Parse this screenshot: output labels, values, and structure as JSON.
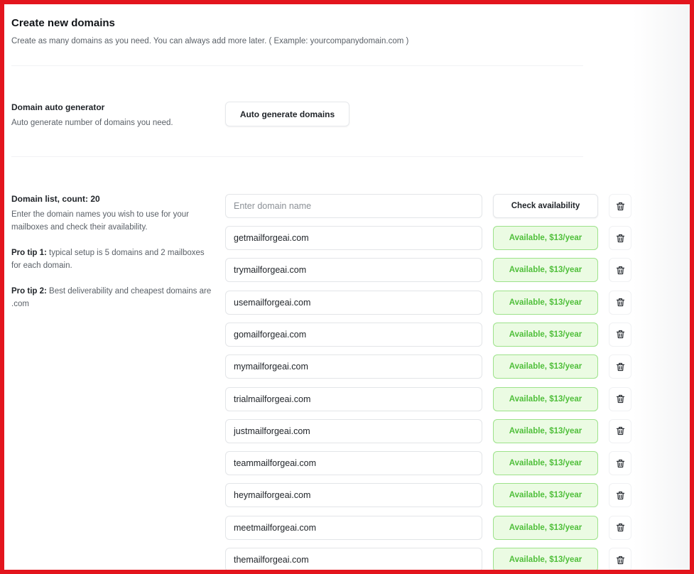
{
  "header": {
    "title": "Create new domains",
    "subtitle": "Create as many domains as you need. You can always add more later. ( Example: yourcompanydomain.com )"
  },
  "auto_generator": {
    "title": "Domain auto generator",
    "description": "Auto generate number of domains you need.",
    "button_label": "Auto generate domains"
  },
  "domain_list": {
    "title": "Domain list, count: 20",
    "description": "Enter the domain names you wish to use for your mailboxes and check their availability.",
    "tip1_label": "Pro tip 1:",
    "tip1_text": " typical setup is 5 domains and 2 mailboxes for each domain.",
    "tip2_label": "Pro tip 2:",
    "tip2_text": " Best deliverability and cheapest domains are .com",
    "new_entry": {
      "placeholder": "Enter domain name",
      "button_label": "Check availability"
    },
    "entries": [
      {
        "domain": "getmailforgeai.com",
        "status": "Available, $13/year"
      },
      {
        "domain": "trymailforgeai.com",
        "status": "Available, $13/year"
      },
      {
        "domain": "usemailforgeai.com",
        "status": "Available, $13/year"
      },
      {
        "domain": "gomailforgeai.com",
        "status": "Available, $13/year"
      },
      {
        "domain": "mymailforgeai.com",
        "status": "Available, $13/year"
      },
      {
        "domain": "trialmailforgeai.com",
        "status": "Available, $13/year"
      },
      {
        "domain": "justmailforgeai.com",
        "status": "Available, $13/year"
      },
      {
        "domain": "teammailforgeai.com",
        "status": "Available, $13/year"
      },
      {
        "domain": "heymailforgeai.com",
        "status": "Available, $13/year"
      },
      {
        "domain": "meetmailforgeai.com",
        "status": "Available, $13/year"
      },
      {
        "domain": "themailforgeai.com",
        "status": "Available, $13/year"
      }
    ]
  },
  "icons": {
    "delete": "trash-icon"
  },
  "colors": {
    "frame_border": "#e3151d",
    "available_bg": "#ebfbe3",
    "available_border": "#9de28a",
    "available_text": "#4fbf3a"
  }
}
